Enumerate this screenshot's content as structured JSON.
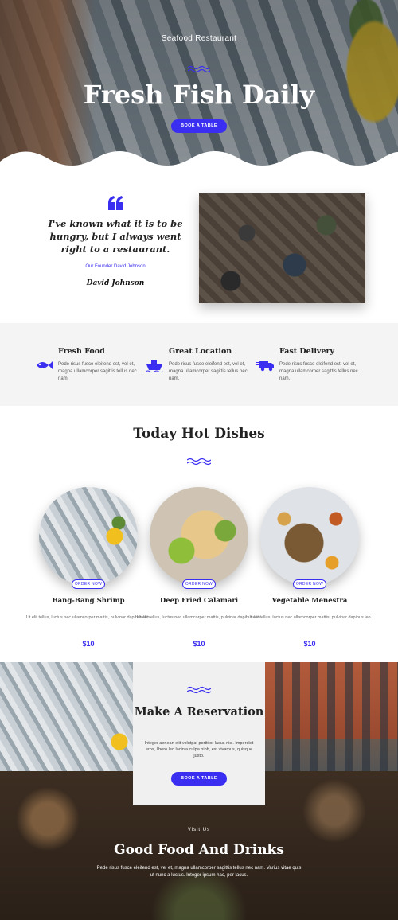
{
  "colors": {
    "accent": "#3a2ef0"
  },
  "hero": {
    "subtitle": "Seafood Restaurant",
    "title": "Fresh Fish Daily",
    "button_label": "BOOK A TABLE"
  },
  "quote": {
    "text": "I've known what it is to be hungry, but I always went right to a restaurant.",
    "founder": "Our Founder David Johnson",
    "signature": "David Johnson"
  },
  "features": [
    {
      "icon": "fish-icon",
      "title": "Fresh Food",
      "text": "Pede risus fusce eleifend est, vel et, magna ullamcorper sagittis tellus nec nam."
    },
    {
      "icon": "ship-icon",
      "title": "Great Location",
      "text": "Pede risus fusce eleifend est, vel et, magna ullamcorper sagittis tellus nec nam."
    },
    {
      "icon": "truck-icon",
      "title": "Fast Delivery",
      "text": "Pede risus fusce eleifend est, vel et, magna ullamcorper sagittis tellus nec nam."
    }
  ],
  "dishes": {
    "title": "Today Hot Dishes",
    "order_label": "ORDER NOW",
    "items": [
      {
        "name": "Bang-Bang Shrimp",
        "text": "Ut elit tellus, luctus nec ullamcorper mattis, pulvinar dapibus leo.",
        "price": "$10"
      },
      {
        "name": "Deep Fried Calamari",
        "text": "Ut elit tellus, luctus nec ullamcorper mattis, pulvinar dapibus leo.",
        "price": "$10"
      },
      {
        "name": "Vegetable Menestra",
        "text": "Ut elit tellus, luctus nec ullamcorper mattis, pulvinar dapibus leo.",
        "price": "$10"
      }
    ]
  },
  "reservation": {
    "title": "Make A Reservation",
    "text": "Integer aenean elit volutpat porttitor lacus nisl. Imperdiet eros, libero leo lacinia culpa nibh, est vivamus, quisque justo.",
    "button_label": "BOOK A TABLE"
  },
  "visit": {
    "label": "Visit Us",
    "title": "Good Food And Drinks",
    "text": "Pede risus fusce eleifend est, vel et, magna ullamcorper sagittis tellus nec nam. Varius vitae quis ut nunc a luctus. Integer ipsum hac, per lacus."
  }
}
